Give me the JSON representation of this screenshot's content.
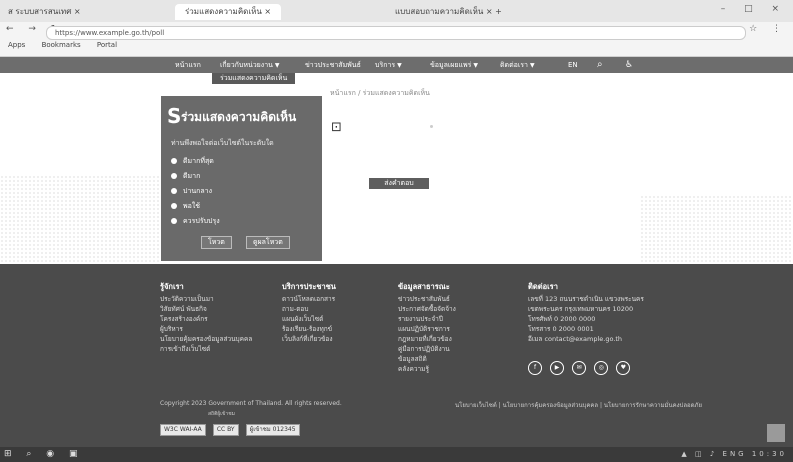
{
  "browser": {
    "tabs": [
      {
        "label": "ส ระบบสารสนเทศ ×",
        "active": false
      },
      {
        "label": "ร่วมแสดงความคิดเห็น ×",
        "active": true
      },
      {
        "label": "แบบสอบถามความคิดเห็น × +",
        "active": false
      }
    ],
    "window_controls": "– □ ×",
    "nav_icons": "← → ↻",
    "url": "https://www.example.go.th/poll",
    "extension_icons": "☆ ⋮",
    "bookmarks": [
      "Apps",
      "Bookmarks",
      "Portal"
    ]
  },
  "navbar": {
    "items": [
      {
        "label": "หน้าแรก",
        "has_chevron": false
      },
      {
        "label": "เกี่ยวกับหน่วยงาน",
        "has_chevron": true
      },
      {
        "label": "ข่าวประชาสัมพันธ์",
        "has_chevron": false
      },
      {
        "label": "บริการ",
        "has_chevron": true
      },
      {
        "label": "ข้อมูลเผยแพร่",
        "has_chevron": true
      },
      {
        "label": "ติดต่อเรา",
        "has_chevron": true
      },
      {
        "label": "EN",
        "has_chevron": false
      }
    ],
    "dropdown_label": "ร่วมแสดงความคิดเห็น",
    "search_icon": "search-icon",
    "accessibility_icon": "accessibility-icon"
  },
  "breadcrumb": "หน้าแรก / ร่วมแสดงความคิดเห็น",
  "poll": {
    "logo_letter": "S",
    "title": "ร่วมแสดงความคิดเห็น",
    "question": "ท่านพึงพอใจต่อเว็บไซต์ในระดับใด",
    "options": [
      "ดีมากที่สุด",
      "ดีมาก",
      "ปานกลาง",
      "พอใช้",
      "ควรปรับปรุง"
    ],
    "vote_label": "โหวต",
    "result_label": "ดูผลโหวต"
  },
  "main": {
    "button_label": "ส่งคำตอบ"
  },
  "footer": {
    "columns": [
      {
        "heading": "รู้จักเรา",
        "items": [
          "ประวัติความเป็นมา",
          "วิสัยทัศน์ พันธกิจ",
          "โครงสร้างองค์กร",
          "ผู้บริหาร",
          "นโยบายคุ้มครองข้อมูลส่วนบุคคล",
          "การเข้าถึงเว็บไซต์"
        ]
      },
      {
        "heading": "บริการประชาชน",
        "items": [
          "ดาวน์โหลดเอกสาร",
          "ถาม-ตอบ",
          "แผนผังเว็บไซต์",
          "ร้องเรียน-ร้องทุกข์",
          "เว็บลิงก์ที่เกี่ยวข้อง"
        ]
      },
      {
        "heading": "ข้อมูลสาธารณะ",
        "items": [
          "ข่าวประชาสัมพันธ์",
          "ประกาศจัดซื้อจัดจ้าง",
          "รายงานประจำปี",
          "แผนปฏิบัติราชการ",
          "กฎหมายที่เกี่ยวข้อง",
          "คู่มือการปฏิบัติงาน",
          "ข้อมูลสถิติ",
          "คลังความรู้"
        ]
      },
      {
        "heading": "ติดต่อเรา",
        "items": [
          "เลขที่ 123 ถนนราชดำเนิน แขวงพระนคร",
          "เขตพระนคร กรุงเทพมหานคร 10200",
          "โทรศัพท์ 0 2000 0000",
          "โทรสาร 0 2000 0001",
          "อีเมล contact@example.go.th"
        ]
      }
    ],
    "social": [
      "f",
      "▶",
      "✉",
      "◎",
      "♥"
    ],
    "copyright": "Copyright 2023 Government of Thailand. All rights reserved.",
    "legal": "นโยบายเว็บไซต์ | นโยบายการคุ้มครองข้อมูลส่วนบุคคล | นโยบายการรักษาความมั่นคงปลอดภัย",
    "badges": [
      "W3C WAI-AA",
      "CC BY",
      "ผู้เข้าชม 012345"
    ],
    "badge_note": "สถิติผู้เข้าชม"
  },
  "taskbar": {
    "left_icons": "⊞ ⌕ ◉ ▣",
    "right_status": "▲ ◫ ♪ ENG 10:30"
  }
}
